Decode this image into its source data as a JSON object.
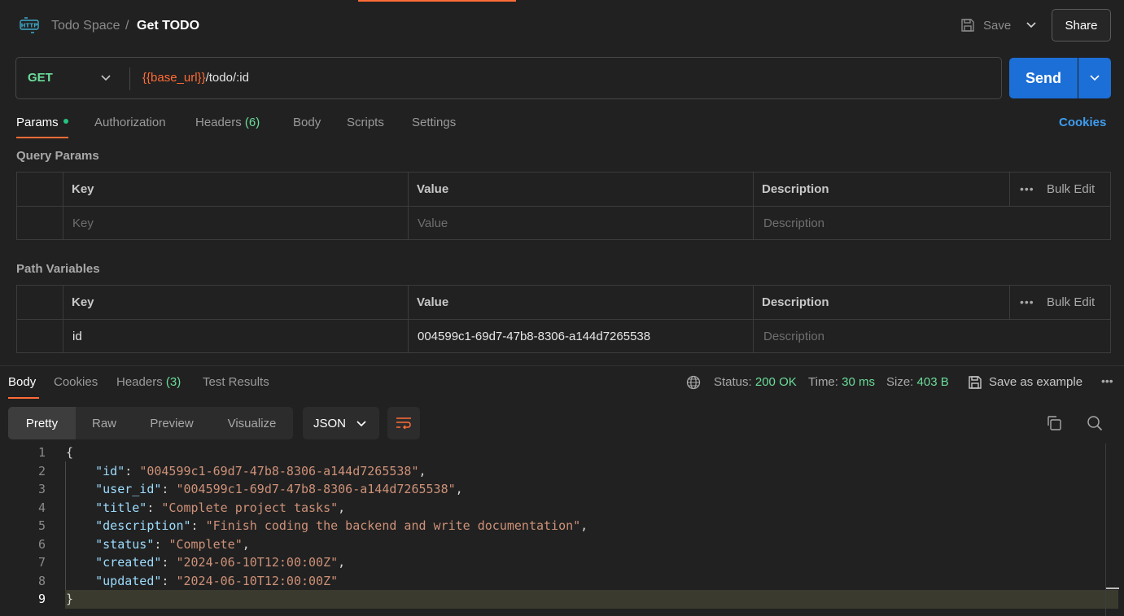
{
  "header": {
    "workspace": "Todo Space",
    "separator": "/",
    "request_title": "Get TODO",
    "save_label": "Save",
    "share_label": "Share"
  },
  "request": {
    "method": "GET",
    "url_variable": "{{base_url}}",
    "url_path": "/todo/:id",
    "send_label": "Send"
  },
  "request_tabs": {
    "params": "Params",
    "authorization": "Authorization",
    "headers": "Headers",
    "headers_count": "(6)",
    "body": "Body",
    "scripts": "Scripts",
    "settings": "Settings",
    "cookies": "Cookies"
  },
  "query_params": {
    "title": "Query Params",
    "columns": [
      "Key",
      "Value",
      "Description"
    ],
    "bulk_edit": "Bulk Edit",
    "placeholders": {
      "key": "Key",
      "value": "Value",
      "description": "Description"
    }
  },
  "path_variables": {
    "title": "Path Variables",
    "columns": [
      "Key",
      "Value",
      "Description"
    ],
    "bulk_edit": "Bulk Edit",
    "row": {
      "key": "id",
      "value": "004599c1-69d7-47b8-8306-a144d7265538",
      "description_placeholder": "Description"
    }
  },
  "response_tabs": {
    "body": "Body",
    "cookies": "Cookies",
    "headers": "Headers",
    "headers_count": "(3)",
    "test_results": "Test Results"
  },
  "response_meta": {
    "status_label": "Status:",
    "status_value": "200 OK",
    "time_label": "Time:",
    "time_value": "30 ms",
    "size_label": "Size:",
    "size_value": "403 B",
    "save_example": "Save as example"
  },
  "view_modes": [
    "Pretty",
    "Raw",
    "Preview",
    "Visualize"
  ],
  "format": "JSON",
  "response_body": {
    "lines": [
      {
        "n": "1",
        "text": "{"
      },
      {
        "n": "2",
        "key": "\"id\"",
        "value": "\"004599c1-69d7-47b8-8306-a144d7265538\"",
        "tail": ","
      },
      {
        "n": "3",
        "key": "\"user_id\"",
        "value": "\"004599c1-69d7-47b8-8306-a144d7265538\"",
        "tail": ","
      },
      {
        "n": "4",
        "key": "\"title\"",
        "value": "\"Complete project tasks\"",
        "tail": ","
      },
      {
        "n": "5",
        "key": "\"description\"",
        "value": "\"Finish coding the backend and write documentation\"",
        "tail": ","
      },
      {
        "n": "6",
        "key": "\"status\"",
        "value": "\"Complete\"",
        "tail": ","
      },
      {
        "n": "7",
        "key": "\"created\"",
        "value": "\"2024-06-10T12:00:00Z\"",
        "tail": ","
      },
      {
        "n": "8",
        "key": "\"updated\"",
        "value": "\"2024-06-10T12:00:00Z\"",
        "tail": ""
      },
      {
        "n": "9",
        "text": "}"
      }
    ]
  },
  "colors": {
    "accent": "#ff6c37",
    "send": "#1c6fd6",
    "success": "#6bdd9a",
    "link": "#3f9df0"
  }
}
